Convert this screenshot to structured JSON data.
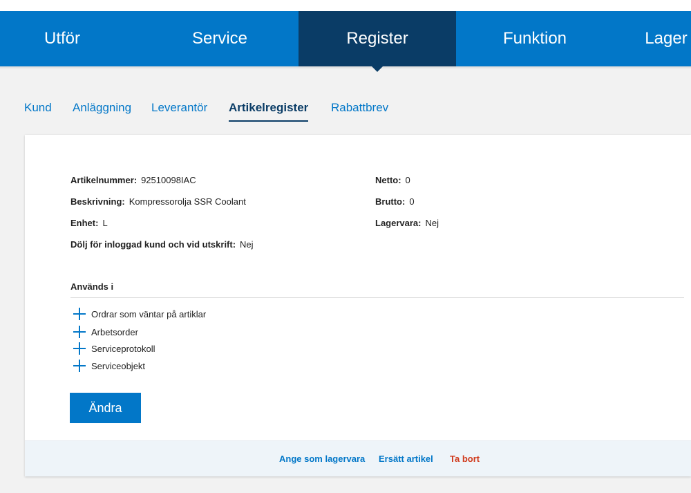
{
  "main_nav": {
    "items": [
      {
        "label": "Utför"
      },
      {
        "label": "Service"
      },
      {
        "label": "Register"
      },
      {
        "label": "Funktion"
      },
      {
        "label": "Lager"
      }
    ],
    "active": "Register"
  },
  "sub_nav": {
    "items": [
      {
        "label": "Kund"
      },
      {
        "label": "Anläggning"
      },
      {
        "label": "Leverantör"
      },
      {
        "label": "Artikelregister"
      },
      {
        "label": "Rabattbrev"
      }
    ],
    "active": "Artikelregister"
  },
  "article": {
    "number_label": "Artikelnummer:",
    "number_value": "92510098IAC",
    "description_label": "Beskrivning:",
    "description_value": "Kompressorolja SSR Coolant",
    "unit_label": "Enhet:",
    "unit_value": "L",
    "hide_label": "Dölj för inloggad kund och vid utskrift:",
    "hide_value": "Nej",
    "net_label": "Netto:",
    "net_value": "0",
    "gross_label": "Brutto:",
    "gross_value": "0",
    "stock_label": "Lagervara:",
    "stock_value": "Nej"
  },
  "used_in": {
    "title": "Används i",
    "items": [
      {
        "label": "Ordrar som väntar på artiklar"
      },
      {
        "label": "Arbetsorder"
      },
      {
        "label": "Serviceprotokoll"
      },
      {
        "label": "Serviceobjekt"
      }
    ]
  },
  "actions": {
    "edit_label": "Ändra",
    "set_stock_label": "Ange som lagervara",
    "replace_label": "Ersätt artikel",
    "delete_label": "Ta bort"
  },
  "colors": {
    "primary": "#0277c8",
    "nav_active": "#0a3c66",
    "danger": "#d0391b",
    "footer_bg": "#eef4f9"
  }
}
